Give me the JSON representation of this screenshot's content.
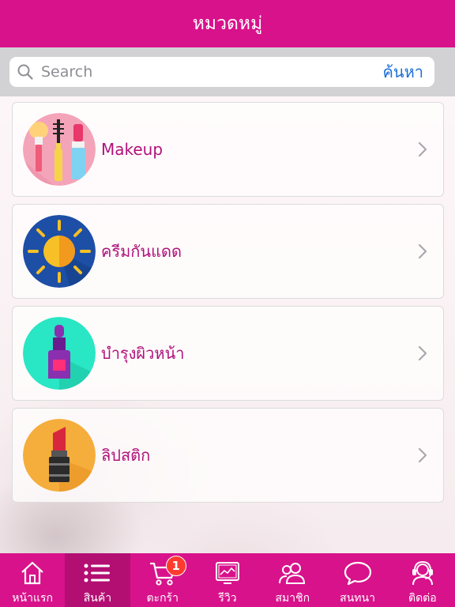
{
  "header": {
    "title": "หมวดหมู่"
  },
  "search": {
    "placeholder": "Search",
    "value": "",
    "button_label": "ค้นหา"
  },
  "categories": [
    {
      "label": "Makeup",
      "icon": "makeup-brushes-icon",
      "color": "#f4a4b8"
    },
    {
      "label": "ครีมกันแดด",
      "icon": "sun-icon",
      "color": "#1d4fa6"
    },
    {
      "label": "บำรุงผิวหน้า",
      "icon": "serum-bottle-icon",
      "color": "#29e6c4"
    },
    {
      "label": "ลิปสติก",
      "icon": "lipstick-icon",
      "color": "#f5ad3b"
    }
  ],
  "tabbar": {
    "tabs": [
      {
        "label": "หน้าแรก",
        "icon": "home-icon",
        "active": false
      },
      {
        "label": "สินค้า",
        "icon": "list-icon",
        "active": true
      },
      {
        "label": "ตะกร้า",
        "icon": "cart-icon",
        "active": false,
        "badge": "1"
      },
      {
        "label": "รีวิว",
        "icon": "review-icon",
        "active": false
      },
      {
        "label": "สมาชิก",
        "icon": "members-icon",
        "active": false
      },
      {
        "label": "สนทนา",
        "icon": "chat-icon",
        "active": false
      },
      {
        "label": "ติดต่อ",
        "icon": "support-icon",
        "active": false
      }
    ]
  },
  "colors": {
    "brand": "#d8128b",
    "active_tab": "#b30f73",
    "link": "#1a6fd8",
    "badge": "#ff3b30"
  }
}
